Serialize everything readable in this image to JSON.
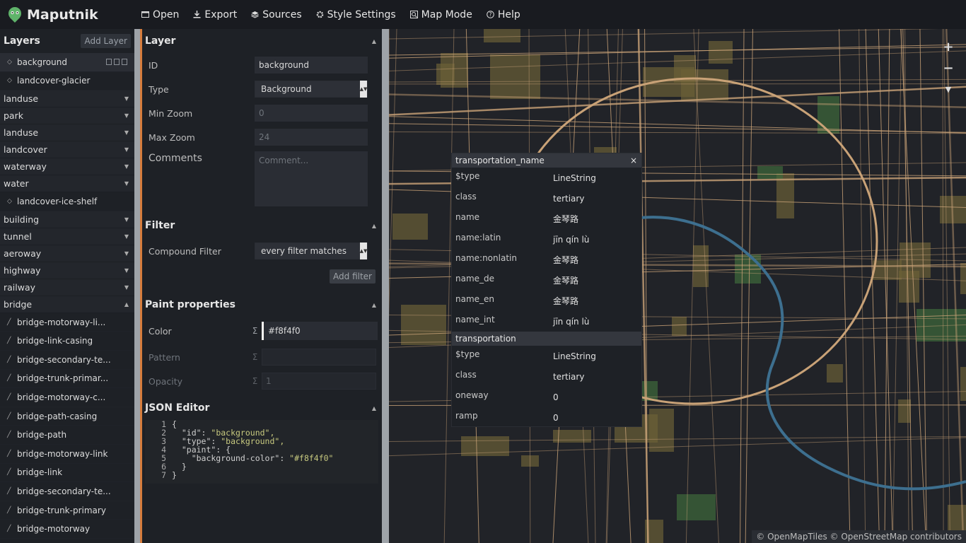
{
  "app": {
    "title": "Maputnik"
  },
  "nav": {
    "open": "Open",
    "export": "Export",
    "sources": "Sources",
    "style_settings": "Style Settings",
    "map_mode": "Map Mode",
    "help": "Help"
  },
  "layers": {
    "title": "Layers",
    "add_layer": "Add Layer",
    "items": [
      {
        "type": "layer",
        "label": "background",
        "icon": "fill-drop-icon",
        "selected": true
      },
      {
        "type": "layer",
        "label": "landcover-glacier",
        "icon": "fill-drop-icon"
      },
      {
        "type": "group",
        "label": "landuse"
      },
      {
        "type": "group",
        "label": "park"
      },
      {
        "type": "group",
        "label": "landuse"
      },
      {
        "type": "group",
        "label": "landcover"
      },
      {
        "type": "group",
        "label": "waterway"
      },
      {
        "type": "group",
        "label": "water"
      },
      {
        "type": "layer",
        "label": "landcover-ice-shelf",
        "icon": "fill-drop-icon"
      },
      {
        "type": "group",
        "label": "building"
      },
      {
        "type": "group",
        "label": "tunnel"
      },
      {
        "type": "group",
        "label": "aeroway"
      },
      {
        "type": "group",
        "label": "highway"
      },
      {
        "type": "group",
        "label": "railway"
      },
      {
        "type": "group",
        "label": "bridge",
        "expanded": true
      },
      {
        "type": "layer",
        "label": "bridge-motorway-li...",
        "icon": "line-icon"
      },
      {
        "type": "layer",
        "label": "bridge-link-casing",
        "icon": "line-icon"
      },
      {
        "type": "layer",
        "label": "bridge-secondary-te...",
        "icon": "line-icon"
      },
      {
        "type": "layer",
        "label": "bridge-trunk-primar...",
        "icon": "line-icon"
      },
      {
        "type": "layer",
        "label": "bridge-motorway-c...",
        "icon": "line-icon"
      },
      {
        "type": "layer",
        "label": "bridge-path-casing",
        "icon": "line-icon"
      },
      {
        "type": "layer",
        "label": "bridge-path",
        "icon": "line-icon"
      },
      {
        "type": "layer",
        "label": "bridge-motorway-link",
        "icon": "line-icon"
      },
      {
        "type": "layer",
        "label": "bridge-link",
        "icon": "line-icon"
      },
      {
        "type": "layer",
        "label": "bridge-secondary-te...",
        "icon": "line-icon"
      },
      {
        "type": "layer",
        "label": "bridge-trunk-primary",
        "icon": "line-icon"
      },
      {
        "type": "layer",
        "label": "bridge-motorway",
        "icon": "line-icon"
      }
    ]
  },
  "editor": {
    "layer_section": {
      "title": "Layer",
      "id_label": "ID",
      "id_value": "background",
      "type_label": "Type",
      "type_value": "Background",
      "minzoom_label": "Min Zoom",
      "minzoom_placeholder": "0",
      "maxzoom_label": "Max Zoom",
      "maxzoom_placeholder": "24",
      "comments_label": "Comments",
      "comments_placeholder": "Comment..."
    },
    "filter_section": {
      "title": "Filter",
      "compound_label": "Compound Filter",
      "compound_value": "every filter matches",
      "add_filter": "Add filter"
    },
    "paint_section": {
      "title": "Paint properties",
      "color_label": "Color",
      "color_value": "#f8f4f0",
      "pattern_label": "Pattern",
      "opacity_label": "Opacity",
      "opacity_placeholder": "1",
      "sigma": "Σ"
    },
    "json_section": {
      "title": "JSON Editor",
      "lines": [
        {
          "num": "1",
          "text": "{",
          "str": ""
        },
        {
          "num": "2",
          "text": "  \"id\": ",
          "str": "\"background\","
        },
        {
          "num": "3",
          "text": "  \"type\": ",
          "str": "\"background\","
        },
        {
          "num": "4",
          "text": "  \"paint\": {",
          "str": ""
        },
        {
          "num": "5",
          "text": "    \"background-color\": ",
          "str": "\"#f8f4f0\""
        },
        {
          "num": "6",
          "text": "  }",
          "str": ""
        },
        {
          "num": "7",
          "text": "}",
          "str": ""
        }
      ]
    }
  },
  "popup": {
    "sections": [
      {
        "title": "transportation_name",
        "close": "×",
        "rows": [
          {
            "key": "$type",
            "value": "LineString"
          },
          {
            "key": "class",
            "value": "tertiary"
          },
          {
            "key": "name",
            "value": "金琴路"
          },
          {
            "key": "name:latin",
            "value": "jīn qín lù"
          },
          {
            "key": "name:nonlatin",
            "value": "金琴路"
          },
          {
            "key": "name_de",
            "value": "金琴路"
          },
          {
            "key": "name_en",
            "value": "金琴路"
          },
          {
            "key": "name_int",
            "value": "jīn qín lù"
          }
        ]
      },
      {
        "title": "transportation",
        "rows": [
          {
            "key": "$type",
            "value": "LineString"
          },
          {
            "key": "class",
            "value": "tertiary"
          },
          {
            "key": "oneway",
            "value": "0"
          },
          {
            "key": "ramp",
            "value": "0"
          }
        ]
      }
    ]
  },
  "map": {
    "zoom_in": "+",
    "zoom_out": "−",
    "compass": "▼",
    "attribution": "© OpenMapTiles © OpenStreetMap contributors"
  },
  "colors": {
    "accent": "#d67c3c",
    "background_color": "#f8f4f0",
    "road": "#c9a277",
    "park": "#3f6a3a",
    "water": "#3d6f8f",
    "landuse": "#6b6036"
  }
}
